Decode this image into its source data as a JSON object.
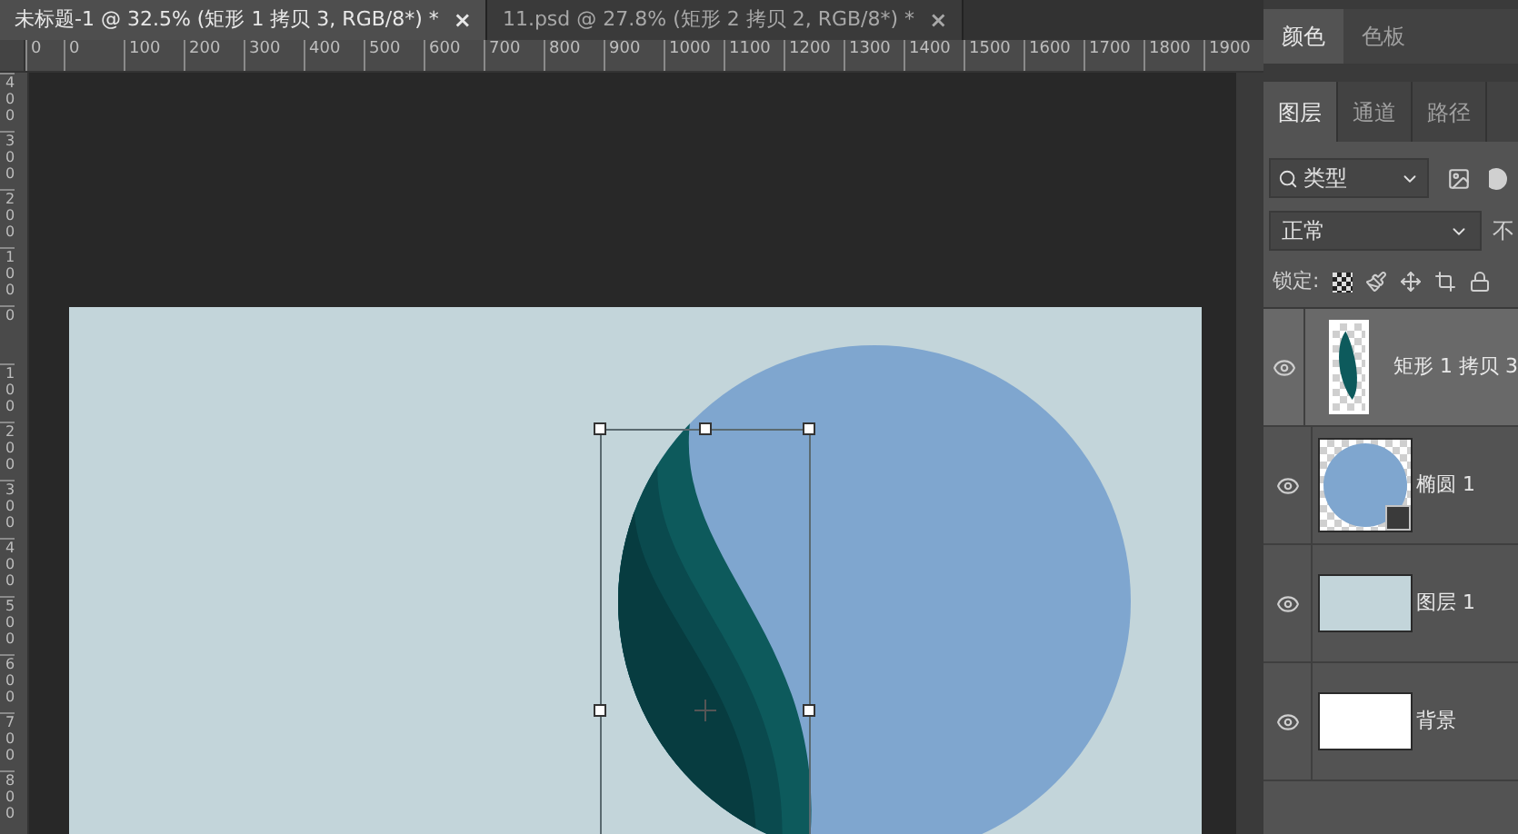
{
  "document_tabs": [
    {
      "label": "未标题-1 @ 32.5% (矩形 1 拷贝 3, RGB/8*) *",
      "close": "×",
      "selected": true
    },
    {
      "label": "11.psd @ 27.8% (矩形 2 拷贝 2, RGB/8*) *",
      "close": "×",
      "selected": false
    }
  ],
  "rulers": {
    "horizontal": [
      "0",
      "0",
      "100",
      "200",
      "300",
      "400",
      "500",
      "600",
      "700",
      "800",
      "900",
      "1000",
      "1100",
      "1200",
      "1300",
      "1400",
      "1500",
      "1600",
      "1700",
      "1800",
      "1900"
    ],
    "vertical": [
      "400",
      "300",
      "200",
      "100",
      "0",
      "100",
      "200",
      "300",
      "400",
      "500",
      "600",
      "700",
      "800"
    ]
  },
  "panels": {
    "color_tabs": [
      {
        "label": "颜色",
        "selected": true
      },
      {
        "label": "色板",
        "selected": false
      }
    ],
    "layer_tabs": [
      {
        "label": "图层",
        "selected": true
      },
      {
        "label": "通道",
        "selected": false
      },
      {
        "label": "路径",
        "selected": false
      }
    ],
    "filter": {
      "value": "类型"
    },
    "blend_mode": {
      "value": "正常"
    },
    "opacity_label": "不",
    "lock_label": "锁定:",
    "layers": [
      {
        "name": "矩形 1 拷贝 3",
        "kind": "leaf",
        "visible": true,
        "selected": true
      },
      {
        "name": "椭圆 1",
        "kind": "ellipse",
        "visible": true,
        "selected": false
      },
      {
        "name": "图层 1",
        "kind": "fill",
        "visible": true,
        "selected": false
      },
      {
        "name": "背景",
        "kind": "white",
        "visible": true,
        "selected": false
      }
    ]
  }
}
